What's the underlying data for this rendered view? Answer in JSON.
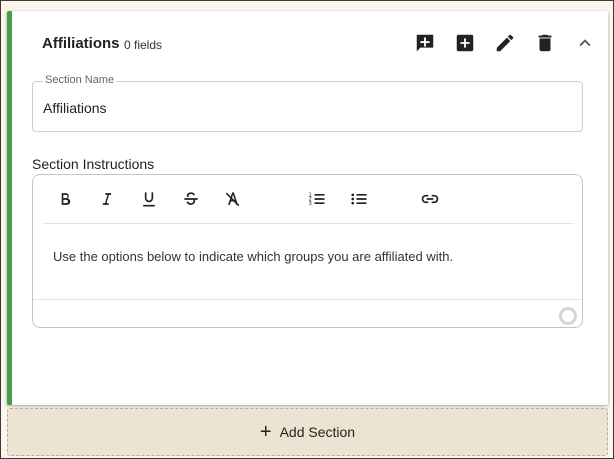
{
  "section": {
    "title": "Affiliations",
    "field_count": "0 fields",
    "accent_color": "#43a047"
  },
  "header_icons": [
    "add-comment-icon",
    "add-box-icon",
    "edit-icon",
    "delete-icon",
    "chevron-up-icon"
  ],
  "name_field": {
    "label": "Section Name",
    "value": "Affiliations"
  },
  "instructions": {
    "label": "Section Instructions",
    "content": "Use the options below to indicate which groups you are affiliated with.",
    "toolbar": [
      "bold-icon",
      "italic-icon",
      "underline-icon",
      "strikethrough-icon",
      "clear-format-icon",
      "numbered-list-icon",
      "bulleted-list-icon",
      "link-icon"
    ]
  },
  "add_section": {
    "label": "Add Section"
  }
}
